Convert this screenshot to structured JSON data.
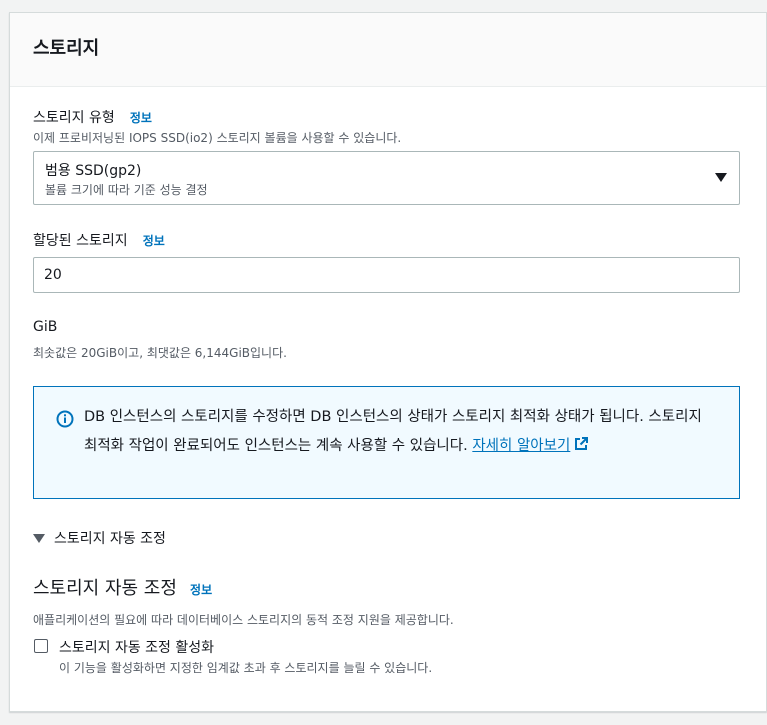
{
  "panel": {
    "title": "스토리지"
  },
  "storage_type": {
    "label": "스토리지 유형",
    "info": "정보",
    "description": "이제 프로비저닝된 IOPS SSD(io2) 스토리지 볼륨을 사용할 수 있습니다.",
    "selected_value": "범용 SSD(gp2)",
    "selected_description": "볼륨 크기에 따라 기준 성능 결정"
  },
  "allocated_storage": {
    "label": "할당된 스토리지",
    "info": "정보",
    "value": "20",
    "unit": "GiB",
    "constraint": "최솟값은 20GiB이고, 최댓값은 6,144GiB입니다."
  },
  "alert": {
    "text": "DB 인스턴스의 스토리지를 수정하면 DB 인스턴스의 상태가 스토리지 최적화 상태가 됩니다. 스토리지 최적화 작업이 완료되어도 인스턴스는 계속 사용할 수 있습니다. ",
    "link_label": "자세히 알아보기",
    "icon": "info-circle-icon"
  },
  "autoscaling": {
    "expander_label": "스토리지 자동 조정",
    "title": "스토리지 자동 조정",
    "info": "정보",
    "description": "애플리케이션의 필요에 따라 데이터베이스 스토리지의 동적 조정 지원을 제공합니다.",
    "checkbox_label": "스토리지 자동 조정 활성화",
    "checkbox_description": "이 기능을 활성화하면 지정한 임계값 초과 후 스토리지를 늘릴 수 있습니다.",
    "checkbox_checked": false
  },
  "colors": {
    "link": "#0073bb",
    "alert_border": "#0073bb",
    "alert_bg": "#f1faff",
    "text": "#16191f",
    "secondary_text": "#545b64"
  }
}
